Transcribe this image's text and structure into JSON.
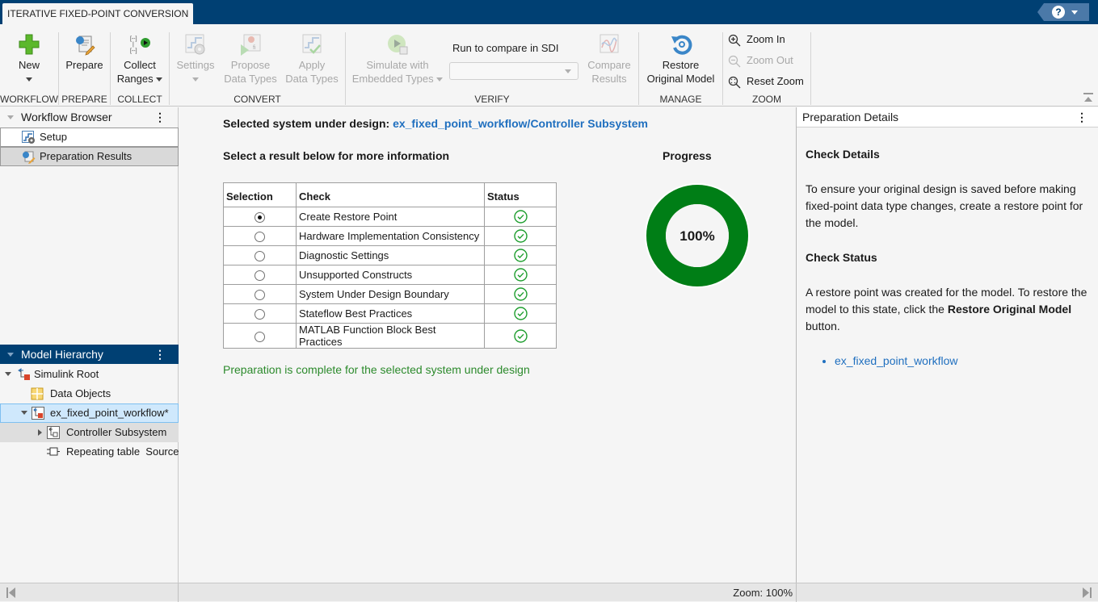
{
  "app": {
    "tab_title": "ITERATIVE FIXED-POINT CONVERSION"
  },
  "ribbon": {
    "workflow": {
      "label": "WORKFLOW",
      "new_label": "New"
    },
    "prepare": {
      "label": "PREPARE",
      "prepare_label": "Prepare"
    },
    "collect": {
      "label": "COLLECT",
      "line1": "Collect",
      "line2": "Ranges"
    },
    "convert": {
      "label": "CONVERT",
      "settings_label": "Settings",
      "propose_line1": "Propose",
      "propose_line2": "Data Types",
      "apply_line1": "Apply",
      "apply_line2": "Data Types"
    },
    "verify": {
      "label": "VERIFY",
      "simulate_line1": "Simulate with",
      "simulate_line2": "Embedded Types",
      "run_compare_label": "Run to compare in SDI",
      "run_compare_value": "",
      "compare_line1": "Compare",
      "compare_line2": "Results"
    },
    "manage": {
      "label": "MANAGE",
      "restore_line1": "Restore",
      "restore_line2": "Original Model"
    },
    "zoom": {
      "label": "ZOOM",
      "zoom_in": "Zoom In",
      "zoom_out": "Zoom Out",
      "reset_zoom": "Reset Zoom"
    }
  },
  "workflow_browser": {
    "title": "Workflow Browser",
    "items": [
      {
        "label": "Setup",
        "icon": "setup-icon"
      },
      {
        "label": "Preparation Results",
        "icon": "prepare-icon",
        "selected": true
      }
    ]
  },
  "model_hierarchy": {
    "title": "Model Hierarchy",
    "nodes": [
      {
        "label": "Simulink Root",
        "icon": "simulink-root-icon"
      },
      {
        "label": "Data Objects",
        "icon": "data-objects-icon"
      },
      {
        "label": "ex_fixed_point_workflow*",
        "icon": "model-icon",
        "selected": true
      },
      {
        "label": "Controller Subsystem",
        "icon": "subsystem-icon"
      },
      {
        "label": "Repeating table  Source",
        "icon": "source-block-icon"
      }
    ]
  },
  "center": {
    "sud_label": "Selected system under design: ",
    "sud_link": "ex_fixed_point_workflow/Controller Subsystem",
    "select_hint": "Select a result below for more information",
    "progress_title": "Progress",
    "progress_percent": 100,
    "progress_text": "100%",
    "progress_color": "#007e16",
    "table": {
      "headers": [
        "Selection",
        "Check",
        "Status"
      ],
      "rows": [
        {
          "check": "Create Restore Point",
          "selected": true,
          "status": "passed"
        },
        {
          "check": "Hardware Implementation Consistency",
          "selected": false,
          "status": "passed"
        },
        {
          "check": "Diagnostic Settings",
          "selected": false,
          "status": "passed"
        },
        {
          "check": "Unsupported Constructs",
          "selected": false,
          "status": "passed"
        },
        {
          "check": "System Under Design Boundary",
          "selected": false,
          "status": "passed"
        },
        {
          "check": "Stateflow Best Practices",
          "selected": false,
          "status": "passed"
        },
        {
          "check": "MATLAB Function Block Best Practices",
          "selected": false,
          "status": "passed"
        }
      ]
    },
    "complete_message": "Preparation is complete for the selected system under design"
  },
  "details": {
    "title": "Preparation Details",
    "check_details_heading": "Check Details",
    "check_details_text": "To ensure your original design is saved before making fixed-point data type changes, create a restore point for the model.",
    "check_status_heading": "Check Status",
    "check_status_text_pre": "A restore point was created for the model. To restore the model to this state, click the ",
    "check_status_text_bold": "Restore Original Model",
    "check_status_text_post": " button.",
    "links": [
      "ex_fixed_point_workflow"
    ]
  },
  "statusbar": {
    "zoom_text": "Zoom: 100%"
  }
}
